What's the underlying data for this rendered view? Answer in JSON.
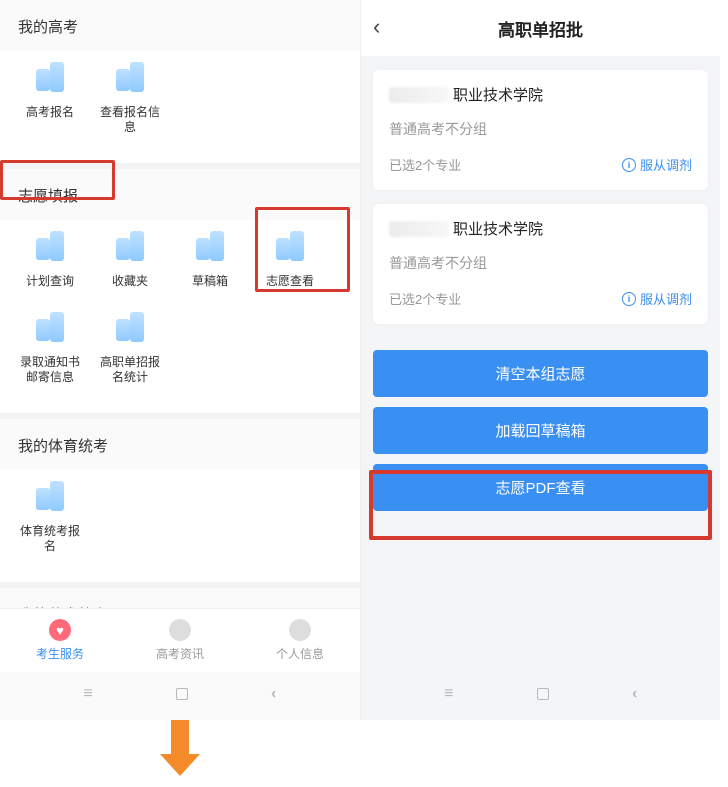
{
  "left": {
    "sections": {
      "gaokao": {
        "title": "我的高考",
        "items": [
          {
            "label": "高考报名"
          },
          {
            "label": "查看报名信\n息"
          }
        ]
      },
      "zhiyuan": {
        "title": "志愿填报",
        "items": [
          {
            "label": "计划查询"
          },
          {
            "label": "收藏夹"
          },
          {
            "label": "草稿箱"
          },
          {
            "label": "志愿查看"
          },
          {
            "label": "录取通知书\n邮寄信息"
          },
          {
            "label": "高职单招报\n名统计"
          }
        ]
      },
      "tiyu": {
        "title": "我的体育统考",
        "items": [
          {
            "label": "体育统考报\n名"
          }
        ]
      },
      "yishu": {
        "title": "我的艺术统考",
        "items": []
      }
    },
    "tabs": [
      {
        "label": "考生服务",
        "active": true
      },
      {
        "label": "高考资讯"
      },
      {
        "label": "个人信息"
      }
    ]
  },
  "right": {
    "title": "高职单招批",
    "cards": [
      {
        "name_suffix": "职业技术学院",
        "sub": "普通高考不分组",
        "selected": "已选2个专业",
        "obey": "服从调剂"
      },
      {
        "name_suffix": "职业技术学院",
        "sub": "普通高考不分组",
        "selected": "已选2个专业",
        "obey": "服从调剂"
      }
    ],
    "buttons": [
      "清空本组志愿",
      "加载回草稿箱",
      "志愿PDF查看"
    ]
  }
}
